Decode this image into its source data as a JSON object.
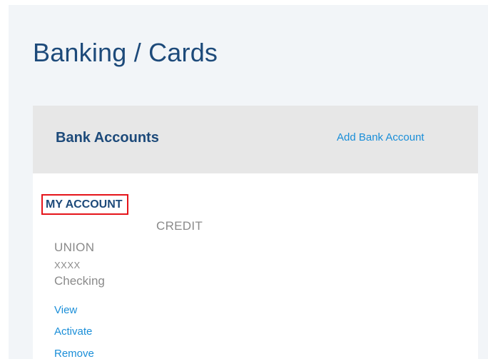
{
  "page": {
    "title": "Banking / Cards"
  },
  "bank_accounts": {
    "title": "Bank Accounts",
    "add_link": "Add Bank Account",
    "account": {
      "name": "MY ACCOUNT",
      "type": "CREDIT",
      "bank": "UNION",
      "mask": "XXXX",
      "kind": "Checking",
      "actions": {
        "view": "View",
        "activate": "Activate",
        "remove": "Remove"
      }
    }
  },
  "colors": {
    "heading": "#1d4a7a",
    "link": "#1a8ed8",
    "highlight_border": "#e5141a",
    "muted_text": "#8a8a8a",
    "header_bg": "#e7e7e7",
    "page_bg": "#f2f5f8"
  }
}
